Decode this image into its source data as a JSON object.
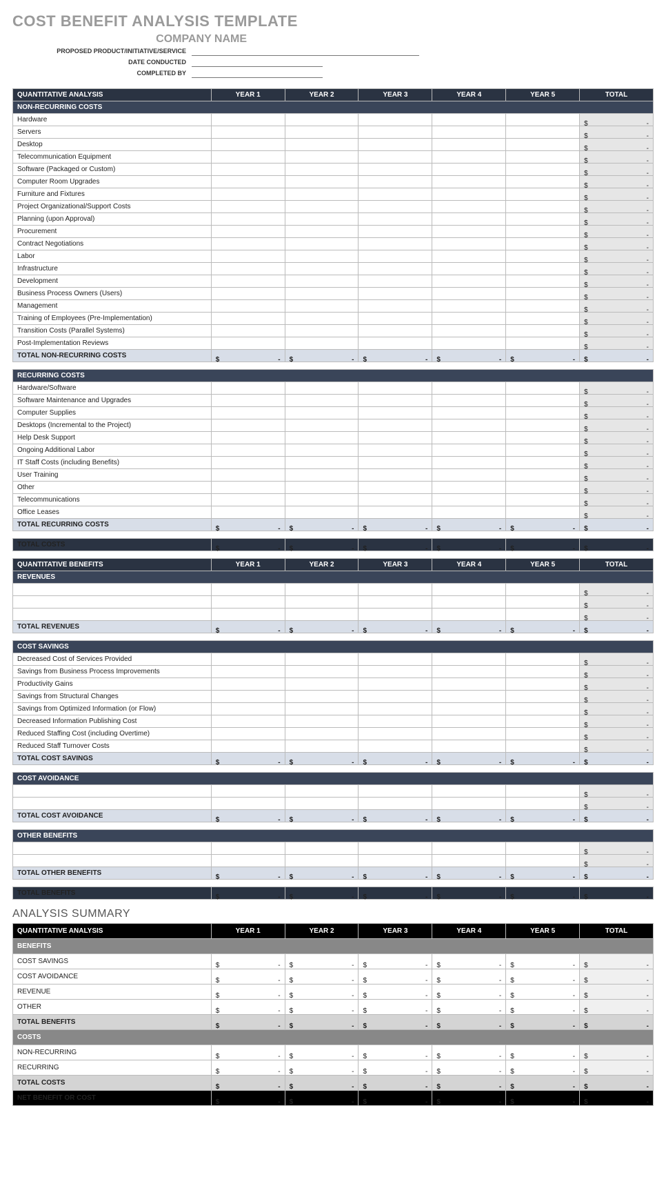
{
  "title": "COST BENEFIT ANALYSIS TEMPLATE",
  "company_label": "COMPANY NAME",
  "meta": {
    "proposed": "PROPOSED PRODUCT/INITIATIVE/SERVICE",
    "date": "DATE CONDUCTED",
    "completed": "COMPLETED BY"
  },
  "headers": {
    "qa": "QUANTITATIVE ANALYSIS",
    "qb": "QUANTITATIVE BENEFITS",
    "y1": "YEAR 1",
    "y2": "YEAR 2",
    "y3": "YEAR 3",
    "y4": "YEAR 4",
    "y5": "YEAR 5",
    "total": "TOTAL"
  },
  "sections": {
    "nonrec": "NON-RECURRING COSTS",
    "rec": "RECURRING COSTS",
    "rev": "REVENUES",
    "sav": "COST SAVINGS",
    "avoid": "COST AVOIDANCE",
    "other": "OTHER BENEFITS",
    "benefits": "BENEFITS",
    "costs": "COSTS"
  },
  "rows": {
    "nonrec": [
      "Hardware",
      "Servers",
      "Desktop",
      "Telecommunication Equipment",
      "Software (Packaged or Custom)",
      "Computer Room Upgrades",
      "Furniture and Fixtures",
      "Project Organizational/Support Costs",
      "Planning (upon Approval)",
      "Procurement",
      "Contract Negotiations",
      "Labor",
      "Infrastructure",
      "Development",
      "Business Process Owners (Users)",
      "Management",
      "Training of Employees (Pre-Implementation)",
      "Transition Costs (Parallel Systems)",
      "Post-Implementation Reviews"
    ],
    "rec": [
      "Hardware/Software",
      "Software Maintenance and Upgrades",
      "Computer Supplies",
      "Desktops (Incremental to the Project)",
      "Help Desk Support",
      "Ongoing Additional Labor",
      "IT Staff Costs (including Benefits)",
      "User Training",
      "Other",
      "Telecommunications",
      "Office Leases"
    ],
    "rev": [
      "",
      "",
      ""
    ],
    "sav": [
      "Decreased Cost of Services Provided",
      "Savings from Business Process Improvements",
      "Productivity Gains",
      "Savings from Structural Changes",
      "Savings from Optimized Information (or Flow)",
      "Decreased Information Publishing Cost",
      "Reduced Staffing Cost (including Overtime)",
      "Reduced Staff Turnover Costs"
    ],
    "avoid": [
      "",
      ""
    ],
    "other": [
      "",
      ""
    ]
  },
  "totals": {
    "nonrec": "TOTAL NON-RECURRING COSTS",
    "rec": "TOTAL RECURRING COSTS",
    "costs": "TOTAL COSTS",
    "rev": "TOTAL REVENUES",
    "sav": "TOTAL COST SAVINGS",
    "avoid": "TOTAL COST AVOIDANCE",
    "other": "TOTAL OTHER BENEFITS",
    "benefits": "TOTAL BENEFITS",
    "net": "NET BENEFIT OR COST"
  },
  "summary": {
    "title": "ANALYSIS SUMMARY",
    "benefits": [
      "COST SAVINGS",
      "COST AVOIDANCE",
      "REVENUE",
      "OTHER"
    ],
    "costs": [
      "NON-RECURRING",
      "RECURRING"
    ]
  }
}
